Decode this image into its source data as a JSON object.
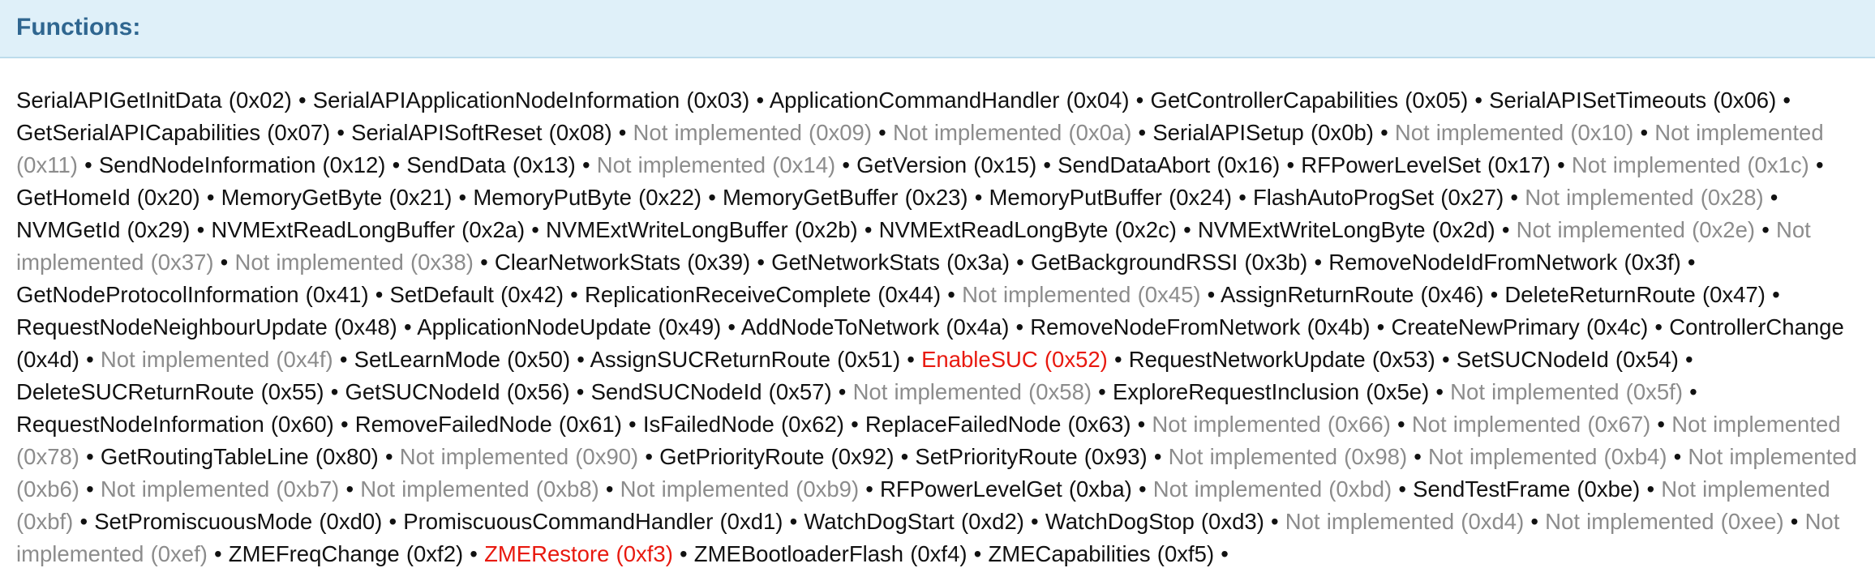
{
  "panel": {
    "title": "Functions:"
  },
  "colors": {
    "header_bg": "#dff0f9",
    "title": "#2f6690",
    "implemented": "#111111",
    "not_implemented": "#8c8c8c",
    "highlighted": "#e8190f"
  },
  "separator": "•",
  "functions": [
    {
      "label": "SerialAPIGetInitData (0x02)",
      "status": "ok"
    },
    {
      "label": "SerialAPIApplicationNodeInformation (0x03)",
      "status": "ok"
    },
    {
      "label": "ApplicationCommandHandler (0x04)",
      "status": "ok"
    },
    {
      "label": "GetControllerCapabilities (0x05)",
      "status": "ok"
    },
    {
      "label": "SerialAPISetTimeouts (0x06)",
      "status": "ok"
    },
    {
      "label": "GetSerialAPICapabilities (0x07)",
      "status": "ok"
    },
    {
      "label": "SerialAPISoftReset (0x08)",
      "status": "ok"
    },
    {
      "label": "Not implemented (0x09)",
      "status": "na"
    },
    {
      "label": "Not implemented (0x0a)",
      "status": "na"
    },
    {
      "label": "SerialAPISetup (0x0b)",
      "status": "ok"
    },
    {
      "label": "Not implemented (0x10)",
      "status": "na"
    },
    {
      "label": "Not implemented (0x11)",
      "status": "na"
    },
    {
      "label": "SendNodeInformation (0x12)",
      "status": "ok"
    },
    {
      "label": "SendData (0x13)",
      "status": "ok"
    },
    {
      "label": "Not implemented (0x14)",
      "status": "na"
    },
    {
      "label": "GetVersion (0x15)",
      "status": "ok"
    },
    {
      "label": "SendDataAbort (0x16)",
      "status": "ok"
    },
    {
      "label": "RFPowerLevelSet (0x17)",
      "status": "ok"
    },
    {
      "label": "Not implemented (0x1c)",
      "status": "na"
    },
    {
      "label": "GetHomeId (0x20)",
      "status": "ok"
    },
    {
      "label": "MemoryGetByte (0x21)",
      "status": "ok"
    },
    {
      "label": "MemoryPutByte (0x22)",
      "status": "ok"
    },
    {
      "label": "MemoryGetBuffer (0x23)",
      "status": "ok"
    },
    {
      "label": "MemoryPutBuffer (0x24)",
      "status": "ok"
    },
    {
      "label": "FlashAutoProgSet (0x27)",
      "status": "ok"
    },
    {
      "label": "Not implemented (0x28)",
      "status": "na"
    },
    {
      "label": "NVMGetId (0x29)",
      "status": "ok"
    },
    {
      "label": "NVMExtReadLongBuffer (0x2a)",
      "status": "ok"
    },
    {
      "label": "NVMExtWriteLongBuffer (0x2b)",
      "status": "ok"
    },
    {
      "label": "NVMExtReadLongByte (0x2c)",
      "status": "ok"
    },
    {
      "label": "NVMExtWriteLongByte (0x2d)",
      "status": "ok"
    },
    {
      "label": "Not implemented (0x2e)",
      "status": "na"
    },
    {
      "label": "Not implemented (0x37)",
      "status": "na"
    },
    {
      "label": "Not implemented (0x38)",
      "status": "na"
    },
    {
      "label": "ClearNetworkStats (0x39)",
      "status": "ok"
    },
    {
      "label": "GetNetworkStats (0x3a)",
      "status": "ok"
    },
    {
      "label": "GetBackgroundRSSI (0x3b)",
      "status": "ok"
    },
    {
      "label": "RemoveNodeIdFromNetwork (0x3f)",
      "status": "ok"
    },
    {
      "label": "GetNodeProtocolInformation (0x41)",
      "status": "ok"
    },
    {
      "label": "SetDefault (0x42)",
      "status": "ok"
    },
    {
      "label": "ReplicationReceiveComplete (0x44)",
      "status": "ok"
    },
    {
      "label": "Not implemented (0x45)",
      "status": "na"
    },
    {
      "label": "AssignReturnRoute (0x46)",
      "status": "ok"
    },
    {
      "label": "DeleteReturnRoute (0x47)",
      "status": "ok"
    },
    {
      "label": "RequestNodeNeighbourUpdate (0x48)",
      "status": "ok"
    },
    {
      "label": "ApplicationNodeUpdate (0x49)",
      "status": "ok"
    },
    {
      "label": "AddNodeToNetwork (0x4a)",
      "status": "ok"
    },
    {
      "label": "RemoveNodeFromNetwork (0x4b)",
      "status": "ok"
    },
    {
      "label": "CreateNewPrimary (0x4c)",
      "status": "ok"
    },
    {
      "label": "ControllerChange (0x4d)",
      "status": "ok"
    },
    {
      "label": "Not implemented (0x4f)",
      "status": "na"
    },
    {
      "label": "SetLearnMode (0x50)",
      "status": "ok"
    },
    {
      "label": "AssignSUCReturnRoute (0x51)",
      "status": "ok"
    },
    {
      "label": "EnableSUC (0x52)",
      "status": "hl"
    },
    {
      "label": "RequestNetworkUpdate (0x53)",
      "status": "ok"
    },
    {
      "label": "SetSUCNodeId (0x54)",
      "status": "ok"
    },
    {
      "label": "DeleteSUCReturnRoute (0x55)",
      "status": "ok"
    },
    {
      "label": "GetSUCNodeId (0x56)",
      "status": "ok"
    },
    {
      "label": "SendSUCNodeId (0x57)",
      "status": "ok"
    },
    {
      "label": "Not implemented (0x58)",
      "status": "na"
    },
    {
      "label": "ExploreRequestInclusion (0x5e)",
      "status": "ok"
    },
    {
      "label": "Not implemented (0x5f)",
      "status": "na"
    },
    {
      "label": "RequestNodeInformation (0x60)",
      "status": "ok"
    },
    {
      "label": "RemoveFailedNode (0x61)",
      "status": "ok"
    },
    {
      "label": "IsFailedNode (0x62)",
      "status": "ok"
    },
    {
      "label": "ReplaceFailedNode (0x63)",
      "status": "ok"
    },
    {
      "label": "Not implemented (0x66)",
      "status": "na"
    },
    {
      "label": "Not implemented (0x67)",
      "status": "na"
    },
    {
      "label": "Not implemented (0x78)",
      "status": "na"
    },
    {
      "label": "GetRoutingTableLine (0x80)",
      "status": "ok"
    },
    {
      "label": "Not implemented (0x90)",
      "status": "na"
    },
    {
      "label": "GetPriorityRoute (0x92)",
      "status": "ok"
    },
    {
      "label": "SetPriorityRoute (0x93)",
      "status": "ok"
    },
    {
      "label": "Not implemented (0x98)",
      "status": "na"
    },
    {
      "label": "Not implemented (0xb4)",
      "status": "na"
    },
    {
      "label": "Not implemented (0xb6)",
      "status": "na"
    },
    {
      "label": "Not implemented (0xb7)",
      "status": "na"
    },
    {
      "label": "Not implemented (0xb8)",
      "status": "na"
    },
    {
      "label": "Not implemented (0xb9)",
      "status": "na"
    },
    {
      "label": "RFPowerLevelGet (0xba)",
      "status": "ok"
    },
    {
      "label": "Not implemented (0xbd)",
      "status": "na"
    },
    {
      "label": "SendTestFrame (0xbe)",
      "status": "ok"
    },
    {
      "label": "Not implemented (0xbf)",
      "status": "na"
    },
    {
      "label": "SetPromiscuousMode (0xd0)",
      "status": "ok"
    },
    {
      "label": "PromiscuousCommandHandler (0xd1)",
      "status": "ok"
    },
    {
      "label": "WatchDogStart (0xd2)",
      "status": "ok"
    },
    {
      "label": "WatchDogStop (0xd3)",
      "status": "ok"
    },
    {
      "label": "Not implemented (0xd4)",
      "status": "na"
    },
    {
      "label": "Not implemented (0xee)",
      "status": "na"
    },
    {
      "label": "Not implemented (0xef)",
      "status": "na"
    },
    {
      "label": "ZMEFreqChange (0xf2)",
      "status": "ok"
    },
    {
      "label": "ZMERestore (0xf3)",
      "status": "hl"
    },
    {
      "label": "ZMEBootloaderFlash (0xf4)",
      "status": "ok"
    },
    {
      "label": "ZMECapabilities (0xf5)",
      "status": "ok"
    }
  ]
}
